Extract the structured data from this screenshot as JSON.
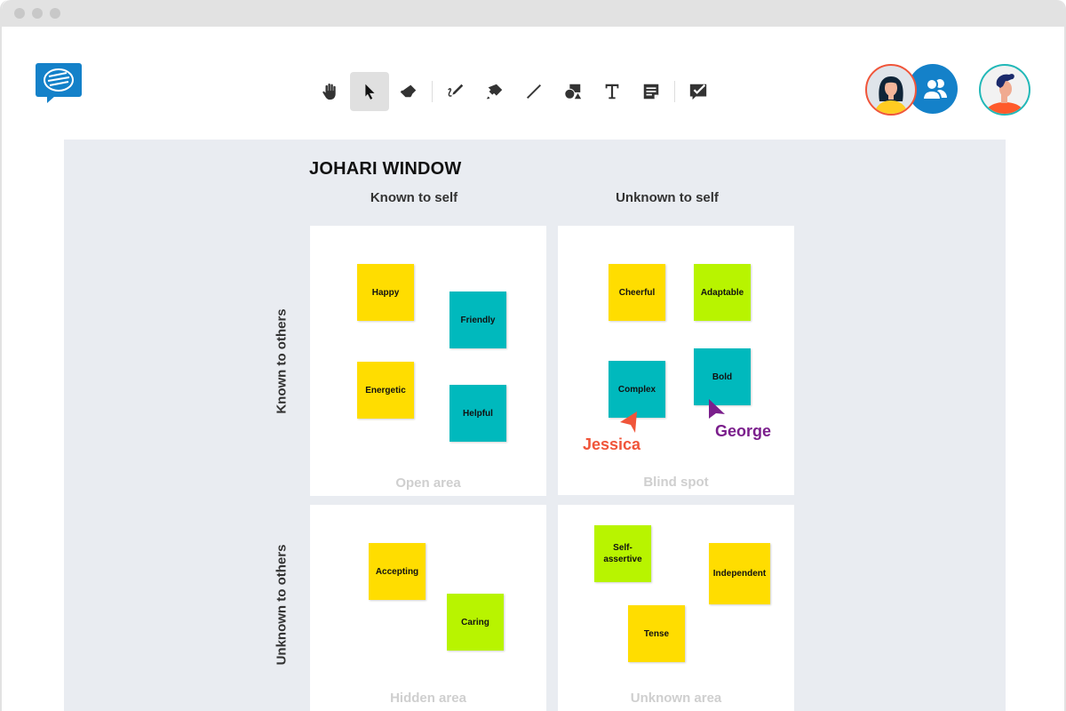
{
  "app": {
    "logo_icon": "chat-bubble-logo-icon",
    "brand_color": "#1481c9"
  },
  "toolbar": {
    "tools": [
      {
        "name": "hand-tool",
        "icon": "hand-icon",
        "active": false
      },
      {
        "name": "select-tool",
        "icon": "pointer-icon",
        "active": true
      },
      {
        "name": "eraser-tool",
        "icon": "eraser-icon",
        "active": false
      },
      {
        "name": "pen-tool",
        "icon": "pen-icon",
        "active": false
      },
      {
        "name": "highlighter-tool",
        "icon": "highlighter-icon",
        "active": false
      },
      {
        "name": "line-tool",
        "icon": "line-icon",
        "active": false
      },
      {
        "name": "shapes-tool",
        "icon": "shapes-icon",
        "active": false
      },
      {
        "name": "text-tool",
        "icon": "text-icon",
        "active": false,
        "glyph": "T"
      },
      {
        "name": "sticky-note-tool",
        "icon": "sticky-note-icon",
        "active": false
      },
      {
        "name": "feedback-tool",
        "icon": "comment-check-icon",
        "active": false
      }
    ]
  },
  "participants": [
    {
      "name": "Jessica",
      "icon": "avatar-woman",
      "ring": "#f0553a"
    },
    {
      "name": "participants-list",
      "icon": "users-icon",
      "color": "#1481c9"
    },
    {
      "name": "George",
      "icon": "avatar-man",
      "ring": "#22b8b8"
    }
  ],
  "board": {
    "title": "JOHARI WINDOW",
    "columns": [
      "Known to self",
      "Unknown to self"
    ],
    "rows": [
      "Known to others",
      "Unknown to others"
    ],
    "colors": {
      "yellow": "#ffdd00",
      "teal": "#00b9bd",
      "lime": "#b8f400"
    },
    "quadrants": [
      {
        "label": "Open area",
        "notes": [
          {
            "text": "Happy",
            "color": "#ffdd00"
          },
          {
            "text": "Friendly",
            "color": "#00b9bd"
          },
          {
            "text": "Energetic",
            "color": "#ffdd00"
          },
          {
            "text": "Helpful",
            "color": "#00b9bd"
          }
        ]
      },
      {
        "label": "Blind spot",
        "notes": [
          {
            "text": "Cheerful",
            "color": "#ffdd00"
          },
          {
            "text": "Adaptable",
            "color": "#b8f400"
          },
          {
            "text": "Complex",
            "color": "#00b9bd"
          },
          {
            "text": "Bold",
            "color": "#00b9bd"
          }
        ]
      },
      {
        "label": "Hidden area",
        "notes": [
          {
            "text": "Accepting",
            "color": "#ffdd00"
          },
          {
            "text": "Caring",
            "color": "#b8f400"
          }
        ]
      },
      {
        "label": "Unknown area",
        "notes": [
          {
            "text": "Self-\nassertive",
            "color": "#b8f400"
          },
          {
            "text": "Independent",
            "color": "#ffdd00"
          },
          {
            "text": "Tense",
            "color": "#ffdd00"
          }
        ]
      }
    ],
    "cursors": [
      {
        "name": "Jessica",
        "color": "#f0553a"
      },
      {
        "name": "George",
        "color": "#7b1f8c"
      }
    ]
  }
}
